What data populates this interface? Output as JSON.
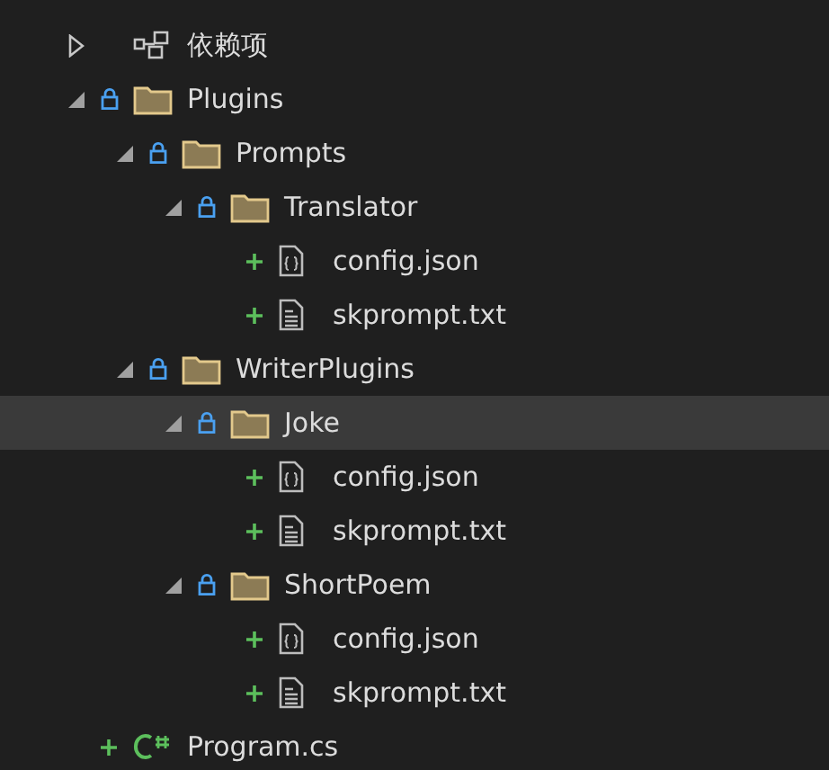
{
  "tree": [
    {
      "kind": "dependencies",
      "label": "依赖项",
      "expanded": false,
      "selected": false
    },
    {
      "kind": "folder",
      "label": "Plugins",
      "expanded": true,
      "locked": true,
      "selected": false,
      "children": [
        {
          "kind": "folder",
          "label": "Prompts",
          "expanded": true,
          "locked": true,
          "selected": false,
          "children": [
            {
              "kind": "folder",
              "label": "Translator",
              "expanded": true,
              "locked": true,
              "selected": false,
              "children": [
                {
                  "kind": "json",
                  "label": "config.json",
                  "added": true,
                  "selected": false
                },
                {
                  "kind": "text",
                  "label": "skprompt.txt",
                  "added": true,
                  "selected": false
                }
              ]
            }
          ]
        },
        {
          "kind": "folder",
          "label": "WriterPlugins",
          "expanded": true,
          "locked": true,
          "selected": false,
          "children": [
            {
              "kind": "folder",
              "label": "Joke",
              "expanded": true,
              "locked": true,
              "selected": true,
              "children": [
                {
                  "kind": "json",
                  "label": "config.json",
                  "added": true,
                  "selected": false
                },
                {
                  "kind": "text",
                  "label": "skprompt.txt",
                  "added": true,
                  "selected": false
                }
              ]
            },
            {
              "kind": "folder",
              "label": "ShortPoem",
              "expanded": true,
              "locked": true,
              "selected": false,
              "children": [
                {
                  "kind": "json",
                  "label": "config.json",
                  "added": true,
                  "selected": false
                },
                {
                  "kind": "text",
                  "label": "skprompt.txt",
                  "added": true,
                  "selected": false
                }
              ]
            }
          ]
        }
      ]
    },
    {
      "kind": "csharp",
      "label": "Program.cs",
      "added": true,
      "selected": false
    }
  ]
}
